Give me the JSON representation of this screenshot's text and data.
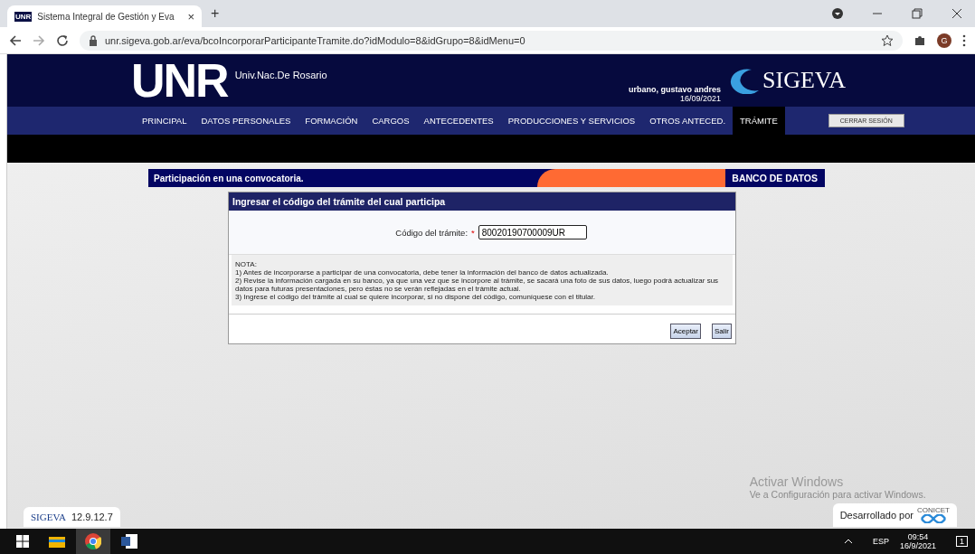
{
  "browser": {
    "tab": {
      "favicon": "UNR",
      "title": "Sistema Integral de Gestión y Eva",
      "close": "×"
    },
    "new_tab": "+",
    "url": "unr.sigeva.gob.ar/eva/bcoIncorporarParticipanteTramite.do?idModulo=8&idGrupo=8&idMenu=0",
    "profile": "G"
  },
  "header": {
    "logo": "UNR",
    "subtitle": "Univ.Nac.De Rosario",
    "user": "urbano, gustavo andres",
    "date": "16/09/2021",
    "brand": "SIGEVA"
  },
  "nav": [
    {
      "label": "PRINCIPAL",
      "selected": false
    },
    {
      "label": "DATOS PERSONALES",
      "selected": false
    },
    {
      "label": "FORMACIÓN",
      "selected": false
    },
    {
      "label": "CARGOS",
      "selected": false
    },
    {
      "label": "ANTECEDENTES",
      "selected": false
    },
    {
      "label": "PRODUCCIONES Y SERVICIOS",
      "selected": false
    },
    {
      "label": "OTROS ANTECED.",
      "selected": false
    },
    {
      "label": "TRÁMITE",
      "selected": true
    }
  ],
  "logout": "CERRAR SESIÓN",
  "banner": {
    "title": "Participación en una convocatoria.",
    "section": "BANCO DE DATOS"
  },
  "dialog": {
    "title": "Ingresar el código del trámite del cual participa",
    "field_label": "Código del trámite:",
    "required_mark": "*",
    "field_value": "80020190700009UR",
    "note": [
      "NOTA:",
      "1) Antes de incorporarse a participar de una convocatoria, debe tener la información del banco de datos actualizada.",
      "2) Revise la información cargada en su banco, ya que una vez que se incorpore al trámite, se sacará una foto de sus datos, luego podrá actualizar sus datos para futuras presentaciones, pero éstas no se verán reflejadas en el trámite actual.",
      "3) Ingrese el código del trámite al cual se quiere incorporar, si no dispone del código, comuníquese con el titular."
    ],
    "buttons": [
      "Aceptar",
      "Salir"
    ]
  },
  "footer": {
    "brand": "SIGEVA",
    "version": "12.9.12.7",
    "developed_by": "Desarrollado por",
    "developer": "CONICET"
  },
  "activation": {
    "title": "Activar Windows",
    "subtitle": "Ve a Configuración para activar Windows."
  },
  "taskbar": {
    "language": "ESP",
    "time": "09:54",
    "date": "16/9/2021",
    "notifications": "1"
  }
}
